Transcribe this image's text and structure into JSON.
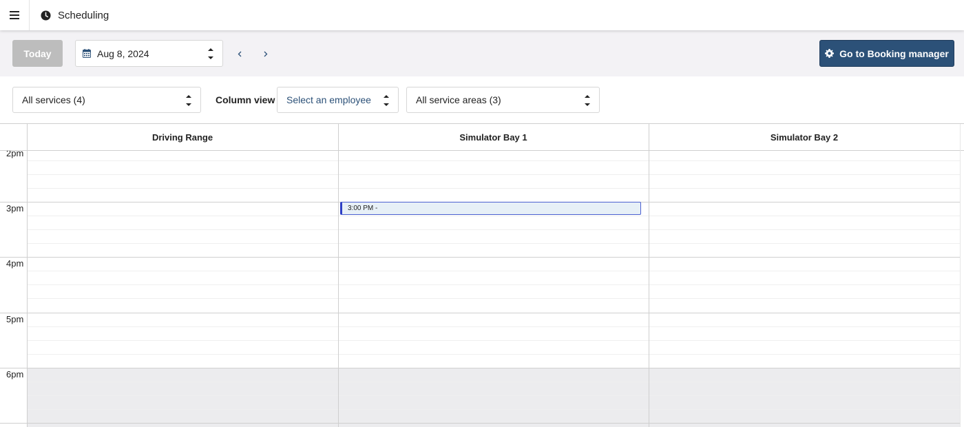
{
  "app": {
    "title": "Scheduling"
  },
  "toolbar": {
    "today_label": "Today",
    "date": "Aug 8, 2024",
    "booking_label": "Go to Booking manager"
  },
  "filters": {
    "services": "All services (4)",
    "column_view_label": "Column view",
    "employee": "Select an employee",
    "service_areas": "All service areas (3)"
  },
  "calendar": {
    "columns": [
      "Driving Range",
      "Simulator Bay 1",
      "Simulator Bay 2"
    ],
    "hours": [
      "2pm",
      "3pm",
      "4pm",
      "5pm",
      "6pm"
    ],
    "events": [
      {
        "column": "Simulator Bay 1",
        "label": "3:00 PM -"
      }
    ]
  },
  "colors": {
    "primary": "#2c5178",
    "today_disabled": "#bdbdbd",
    "toolbar_bg": "#f3f2f5",
    "event_bg": "#e7f0f7",
    "event_border": "#2d3fc4"
  }
}
